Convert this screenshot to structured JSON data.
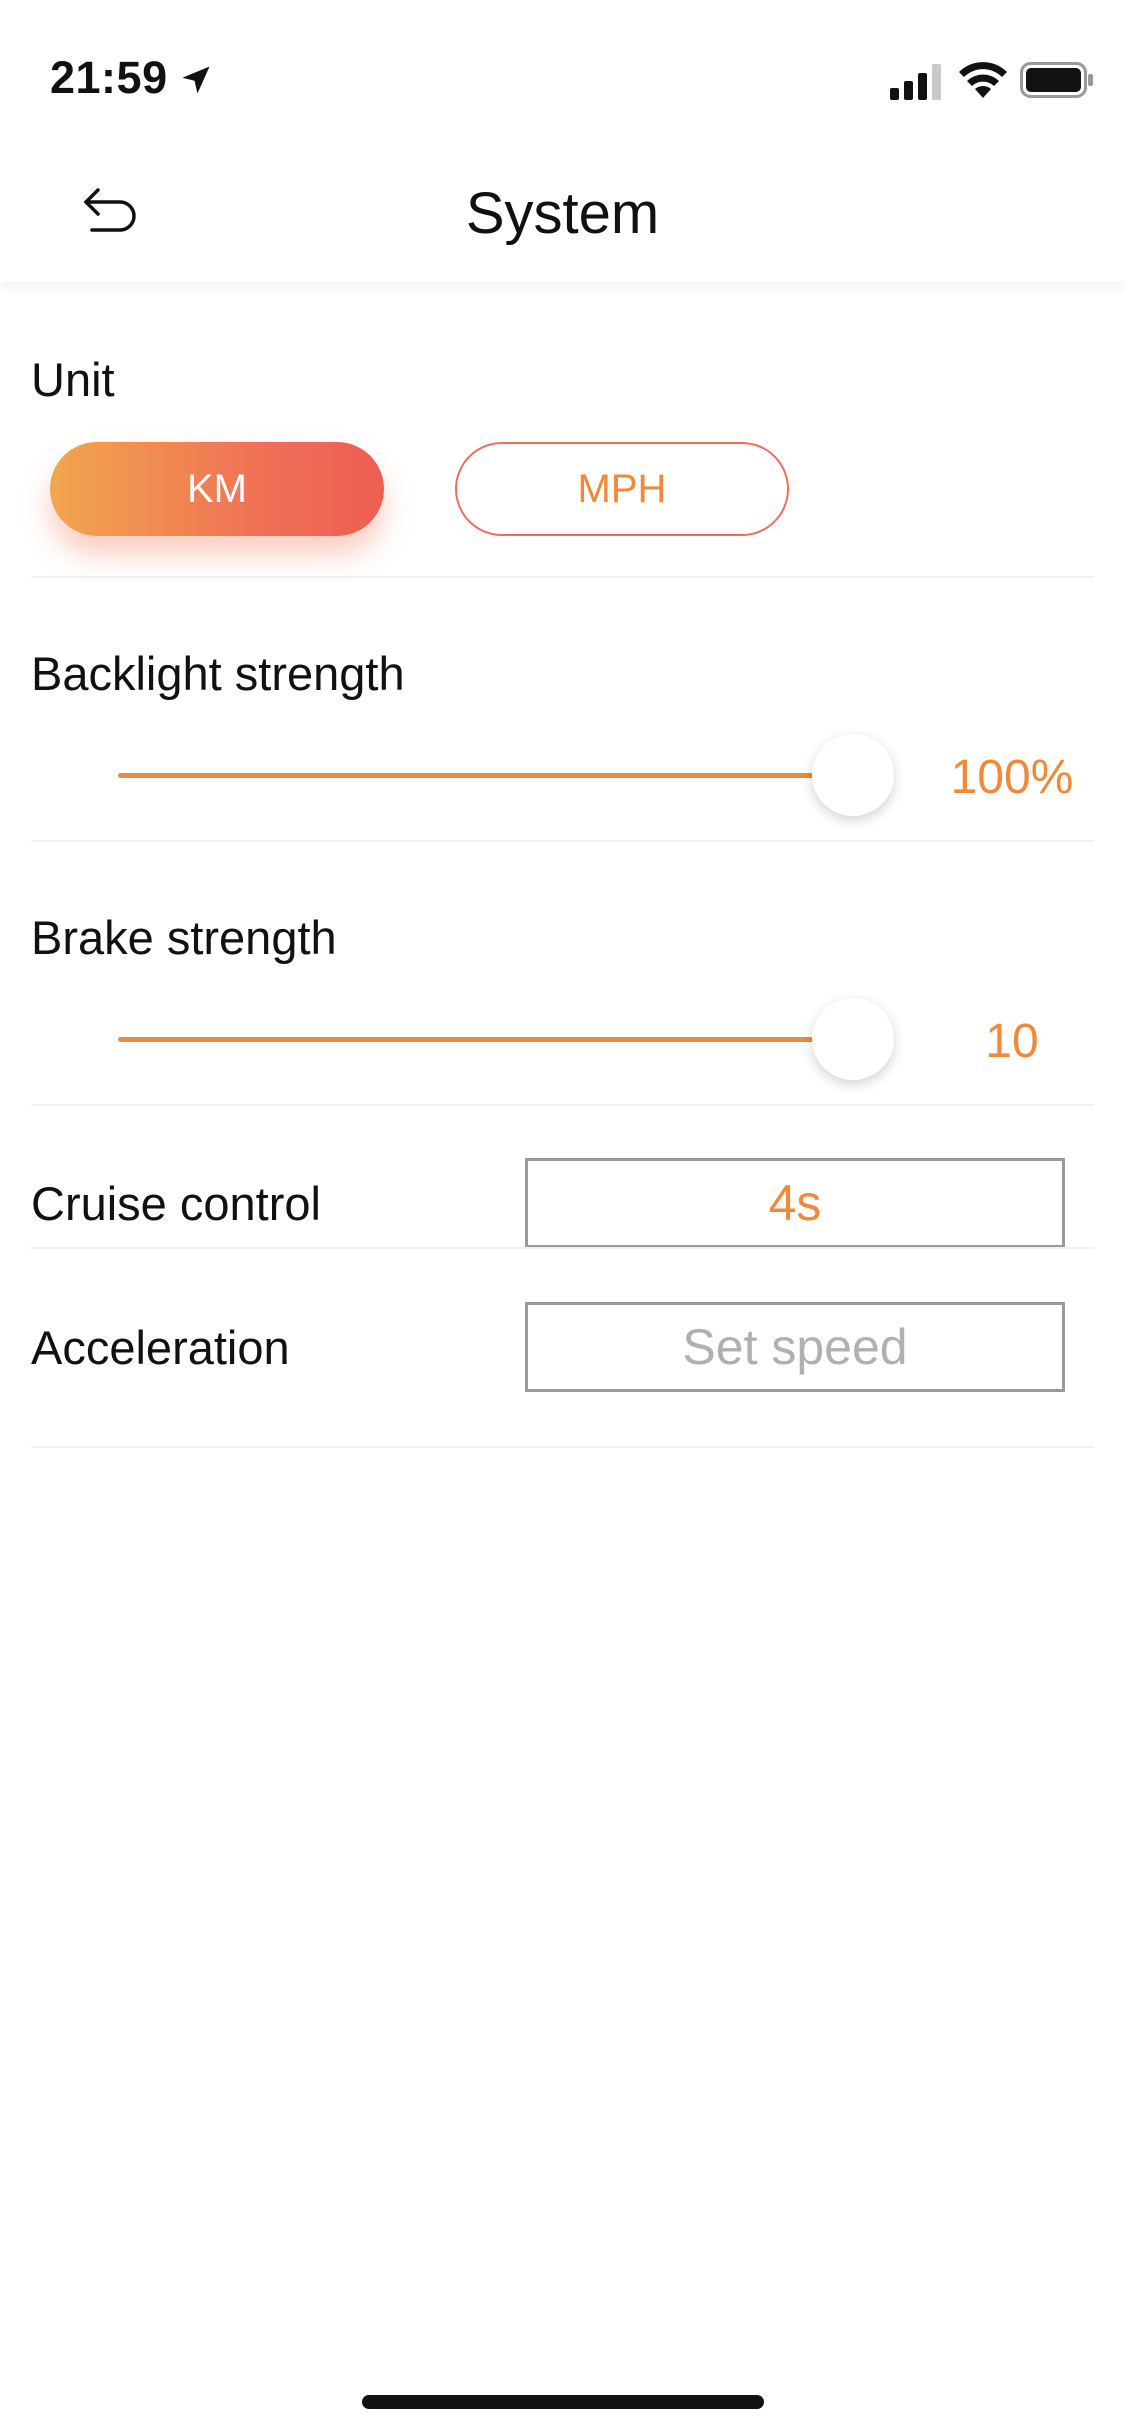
{
  "status_bar": {
    "time": "21:59",
    "location_icon": "location-arrow-icon",
    "signal_icon": "cellular-signal-icon",
    "wifi_icon": "wifi-icon",
    "battery_icon": "battery-icon"
  },
  "header": {
    "title": "System",
    "back_icon": "back-arrow-icon"
  },
  "unit": {
    "label": "Unit",
    "options": [
      "KM",
      "MPH"
    ],
    "selected": "KM"
  },
  "backlight": {
    "label": "Backlight strength",
    "value_text": "100%",
    "level": 1.0
  },
  "brake": {
    "label": "Brake strength",
    "value_text": "10",
    "level": 1.0
  },
  "cruise_control": {
    "label": "Cruise control",
    "value": "4s"
  },
  "acceleration": {
    "label": "Acceleration",
    "placeholder": "Set speed",
    "value": ""
  },
  "colors": {
    "accent": "#ee8a3a",
    "gradient_start": "#f2a650",
    "gradient_end": "#ee5e54",
    "mph_border": "#ee6e5e"
  }
}
